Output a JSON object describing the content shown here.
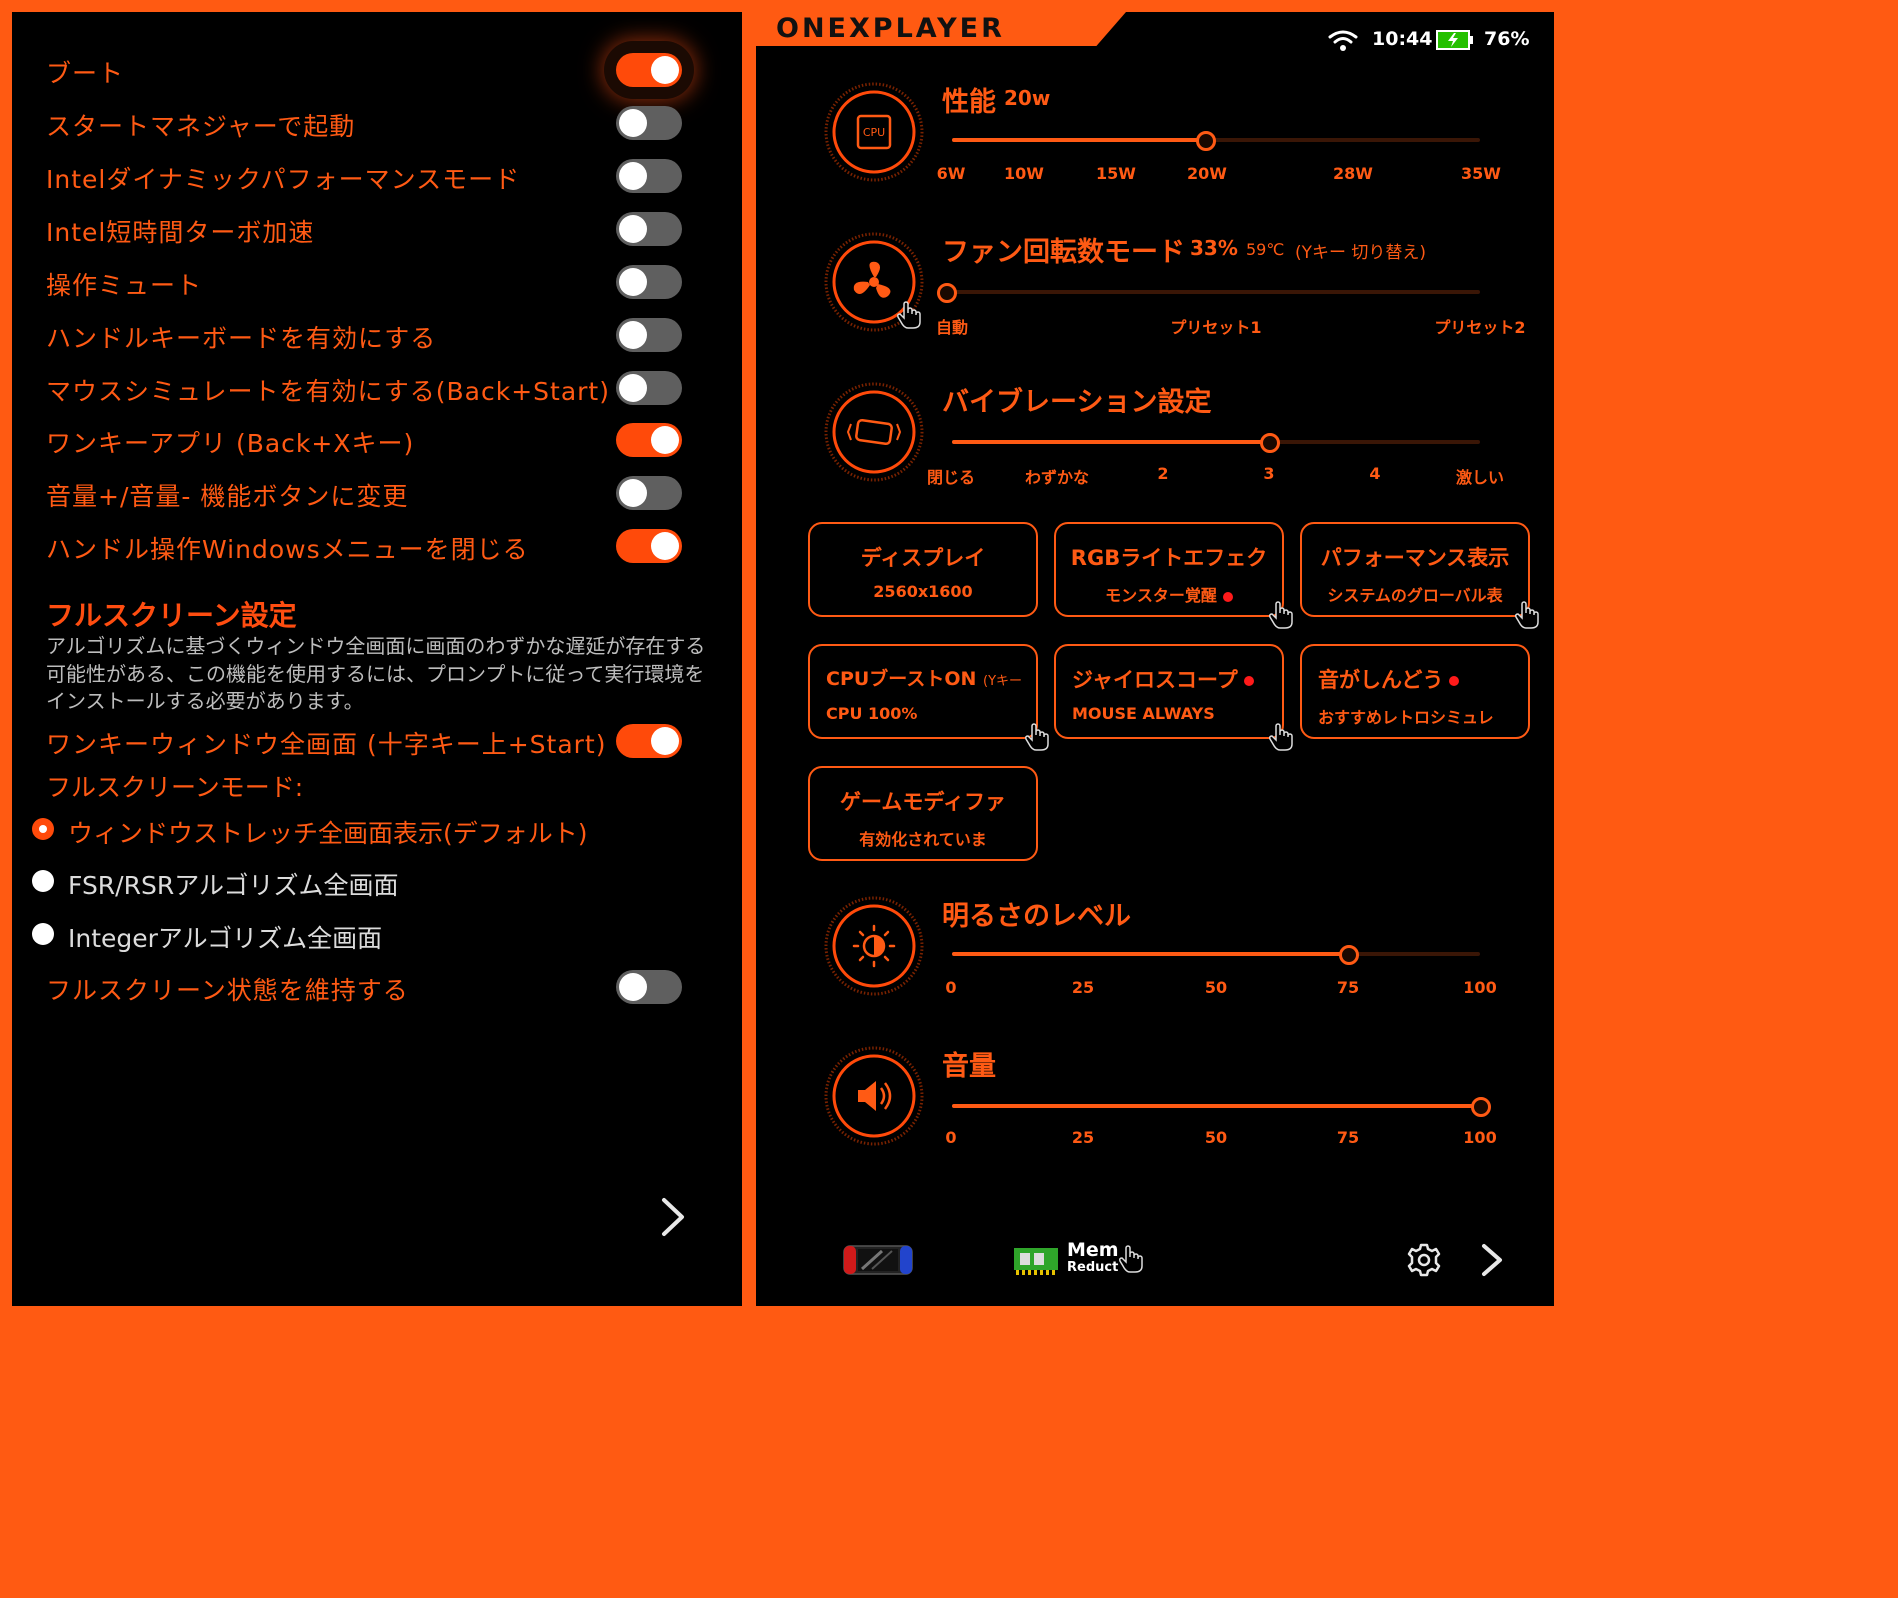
{
  "left": {
    "settings": [
      {
        "label": "ブート",
        "on": true
      },
      {
        "label": "スタートマネジャーで起動",
        "on": false
      },
      {
        "label": "Intelダイナミックパフォーマンスモード",
        "on": false
      },
      {
        "label": "Intel短時間ターボ加速",
        "on": false
      },
      {
        "label": "操作ミュート",
        "on": false
      },
      {
        "label": "ハンドルキーボードを有効にする",
        "on": false
      },
      {
        "label": "マウスシミュレートを有効にする(Back+Start)",
        "on": false
      },
      {
        "label": "ワンキーアプリ (Back+Xキー)",
        "on": true
      },
      {
        "label": "音量+/音量- 機能ボタンに変更",
        "on": false
      },
      {
        "label": "ハンドル操作Windowsメニューを閉じる",
        "on": true
      }
    ],
    "fullscreen": {
      "title": "フルスクリーン設定",
      "description": "アルゴリズムに基づくウィンドウ全画面に画面のわずかな遅延が存在する可能性がある、この機能を使用するには、プロンプトに従って実行環境をインストールする必要があります。",
      "onekey_label": "ワンキーウィンドウ全画面 (十字キー上+Start)",
      "onekey_on": true,
      "mode_label": "フルスクリーンモード:",
      "modes": [
        {
          "label": "ウィンドウストレッチ全画面表示(デフォルト)",
          "selected": true
        },
        {
          "label": "FSR/RSRアルゴリズム全画面",
          "selected": false
        },
        {
          "label": "Integerアルゴリズム全画面",
          "selected": false
        }
      ],
      "keep_label": "フルスクリーン状態を維持する",
      "keep_on": false
    }
  },
  "right": {
    "brand": "ONEXPLAYER",
    "status": {
      "time": "10:44",
      "battery": "76%"
    },
    "performance": {
      "title": "性能",
      "value": "20w",
      "ticks": [
        "6W",
        "10W",
        "15W",
        "20W",
        "28W",
        "35W"
      ],
      "level": 0.48
    },
    "fan": {
      "title": "ファン回転数モード",
      "value": "33%",
      "temp": "59℃",
      "hint": "(Yキー 切り替え)",
      "ticks": [
        "自動",
        "プリセット1",
        "プリセット2"
      ],
      "level": 0.0
    },
    "vibration": {
      "title": "バイブレーション設定",
      "ticks": [
        "閉じる",
        "わずかな",
        "2",
        "3",
        "4",
        "激しい"
      ],
      "level": 0.6
    },
    "tiles": [
      {
        "title": "ディスプレイ",
        "sub": "2560x1600",
        "dot": false,
        "hand": false
      },
      {
        "title": "RGBライトエフェク",
        "sub": "モンスター覚醒",
        "dot": true,
        "hand": true
      },
      {
        "title": "パフォーマンス表示",
        "sub": "システムのグローバル表",
        "dot": false,
        "hand": true
      },
      {
        "title": "CPUブーストON",
        "title_hint": "(Yキー",
        "sub": "CPU 100%",
        "dot": false,
        "hand": true
      },
      {
        "title": "ジャイロスコープ",
        "sub": "MOUSE ALWAYS",
        "dot": true,
        "hand": true
      },
      {
        "title": "音がしんどう",
        "sub": "おすすめレトロシミュレ",
        "dot": true,
        "hand": false
      },
      {
        "title": "ゲームモディファ",
        "sub": "有効化されていま",
        "dot": false,
        "hand": false
      }
    ],
    "brightness": {
      "title": "明るさのレベル",
      "ticks": [
        "0",
        "25",
        "50",
        "75",
        "100"
      ],
      "level": 0.75
    },
    "volume": {
      "title": "音量",
      "ticks": [
        "0",
        "25",
        "50",
        "75",
        "100"
      ],
      "level": 1.0
    },
    "bottom": {
      "mem_label": "Mem",
      "mem_sub": "Reduct"
    }
  }
}
